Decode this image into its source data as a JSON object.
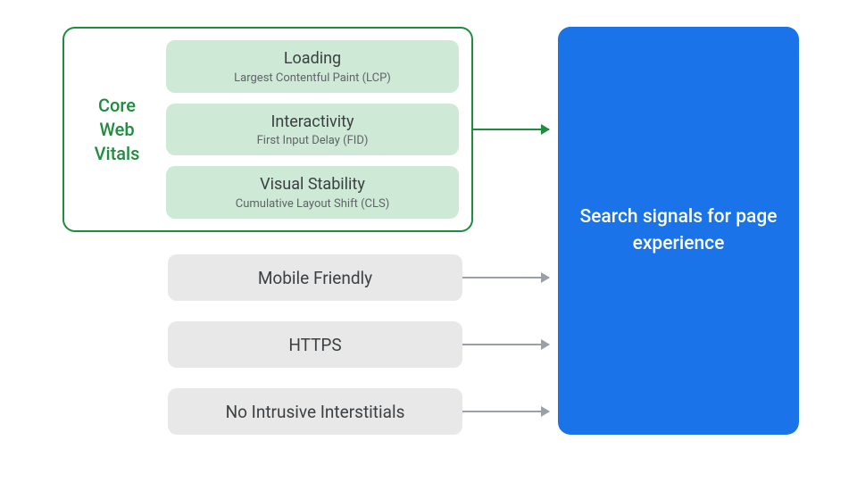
{
  "coreWebVitals": {
    "label": "Core\nWeb\nVitals",
    "items": [
      {
        "title": "Loading",
        "sub": "Largest Contentful Paint (LCP)"
      },
      {
        "title": "Interactivity",
        "sub": "First Input Delay (FID)"
      },
      {
        "title": "Visual Stability",
        "sub": "Cumulative Layout Shift (CLS)"
      }
    ]
  },
  "otherSignals": [
    "Mobile Friendly",
    "HTTPS",
    "No Intrusive Interstitials"
  ],
  "target": "Search signals for page experience",
  "colors": {
    "green": "#1e8e3e",
    "greenLight": "#ceead6",
    "grayPill": "#e8e8e8",
    "grayArrow": "#9aa0a6",
    "blue": "#1a73e8"
  }
}
